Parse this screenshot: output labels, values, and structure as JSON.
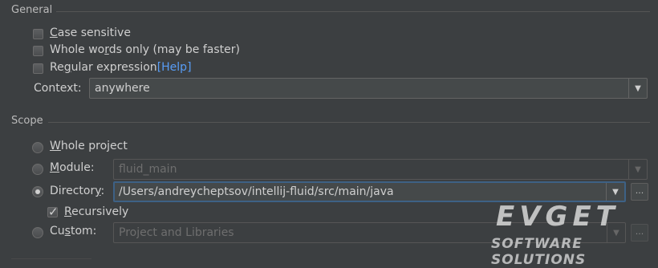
{
  "general": {
    "title": "General",
    "case_sensitive": {
      "label_u": "C",
      "label_rest": "ase sensitive",
      "checked": false
    },
    "whole_words": {
      "label_pre": "Whole wo",
      "label_u": "r",
      "label_rest": "ds only (may be faster)",
      "checked": false
    },
    "regex": {
      "label_pre": "Re",
      "label_u": "g",
      "label_rest": "ular expression",
      "help_link": "[Help]",
      "checked": false
    },
    "context": {
      "label": "Context:",
      "value": "anywhere"
    }
  },
  "scope": {
    "title": "Scope",
    "whole_project": {
      "label_u": "W",
      "label_rest": "hole project"
    },
    "module": {
      "label_u": "M",
      "label_rest": "odule:",
      "value": "fluid_main"
    },
    "directory": {
      "label_pre": "Director",
      "label_u": "y",
      "label_rest": ":",
      "value": "/Users/andreycheptsov/intellij-fluid/src/main/java",
      "browse_label": "..."
    },
    "recursively": {
      "label_u": "R",
      "label_rest": "ecursively",
      "checked": true
    },
    "custom": {
      "label_pre": "Cu",
      "label_u": "s",
      "label_rest": "tom:",
      "value": "Project and Libraries",
      "browse_label": "..."
    },
    "selected": "directory"
  },
  "watermark": {
    "line1": "EVGET",
    "line2": "SOFTWARE SOLUTIONS"
  },
  "colors": {
    "background": "#3c3f41",
    "link": "#589df6",
    "focus_border": "#3d6185"
  }
}
